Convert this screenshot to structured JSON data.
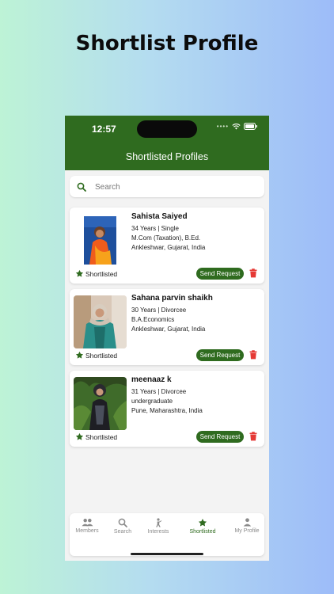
{
  "headline": "Shortlist Profile",
  "status_bar": {
    "time": "12:57"
  },
  "app_bar": {
    "title": "Shortlisted Profiles"
  },
  "search": {
    "placeholder": "Search"
  },
  "profiles": [
    {
      "name": "Sahista Saiyed",
      "details": "34 Years | Single",
      "education": "M.Com (Taxation), B.Ed.",
      "location": "Ankleshwar, Gujarat, India",
      "status": "Shortlisted",
      "action": "Send Request"
    },
    {
      "name": "Sahana parvin shaikh",
      "details": "30 Years | Divorcee",
      "education": "B.A.Economics",
      "location": "Ankleshwar, Gujarat, India",
      "status": "Shortlisted",
      "action": "Send Request"
    },
    {
      "name": "meenaaz k",
      "details": "31 Years | Divorcee",
      "education": "undergraduate",
      "location": "Pune, Maharashtra, India",
      "status": "Shortlisted",
      "action": "Send Request"
    }
  ],
  "bottom_nav": [
    {
      "label": "Members",
      "icon": "members-icon"
    },
    {
      "label": "Search",
      "icon": "search-icon"
    },
    {
      "label": "Interests",
      "icon": "interests-icon"
    },
    {
      "label": "Shortlisted",
      "icon": "star-icon",
      "active": true
    },
    {
      "label": "My Profile",
      "icon": "person-icon"
    }
  ],
  "colors": {
    "primary": "#2f6b1f",
    "delete": "#e53935",
    "inactive": "#8a8a8a"
  }
}
